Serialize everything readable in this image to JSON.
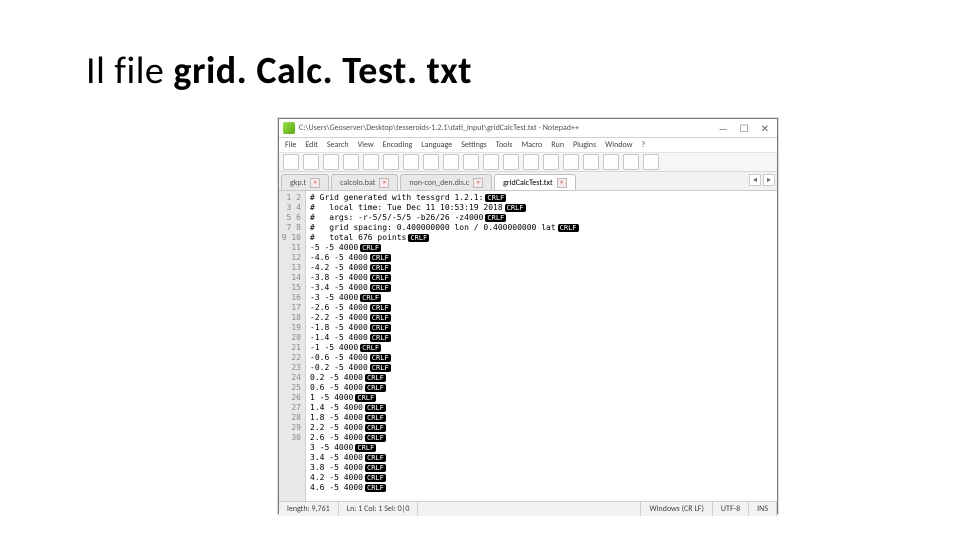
{
  "heading": {
    "prefix": "Il file ",
    "bold": "grid. Calc. Test. txt"
  },
  "titlebar": "C:\\Users\\Geoserver\\Desktop\\tesseroids-1.2.1\\dati_input\\gridCalcTest.txt - Notepad++",
  "winbtns": {
    "min": "—",
    "max": "☐",
    "close": "✕"
  },
  "menus": [
    "File",
    "Edit",
    "Search",
    "View",
    "Encoding",
    "Language",
    "Settings",
    "Tools",
    "Macro",
    "Run",
    "Plugins",
    "Window",
    "?"
  ],
  "tabs": [
    {
      "label": "gkp.t",
      "active": false
    },
    {
      "label": "calcolo.bat",
      "active": false
    },
    {
      "label": "non-con_den.dis.c",
      "active": false
    },
    {
      "label": "gridCalcTest.txt",
      "active": true
    }
  ],
  "code_lines": [
    "# Grid generated with tessgrd 1.2.1:",
    "#   local time: Tue Dec 11 10:53:19 2018",
    "#   args: -r-5/5/-5/5 -b26/26 -z4000",
    "#   grid spacing: 0.400000000 lon / 0.400000000 lat",
    "#   total 676 points",
    "-5 -5 4000",
    "-4.6 -5 4000",
    "-4.2 -5 4000",
    "-3.8 -5 4000",
    "-3.4 -5 4000",
    "-3 -5 4000",
    "-2.6 -5 4000",
    "-2.2 -5 4000",
    "-1.8 -5 4000",
    "-1.4 -5 4000",
    "-1 -5 4000",
    "-0.6 -5 4000",
    "-0.2 -5 4000",
    "0.2 -5 4000",
    "0.6 -5 4000",
    "1 -5 4000",
    "1.4 -5 4000",
    "1.8 -5 4000",
    "2.2 -5 4000",
    "2.6 -5 4000",
    "3 -5 4000",
    "3.4 -5 4000",
    "3.8 -5 4000",
    "4.2 -5 4000",
    "4.6 -5 4000"
  ],
  "crlf": "CRLF",
  "status": {
    "length": "length: 9,761",
    "pos": "Ln: 1   Col: 1   Sel: 0|0",
    "eol": "Windows (CR LF)",
    "enc": "UTF-8",
    "mode": "INS"
  }
}
